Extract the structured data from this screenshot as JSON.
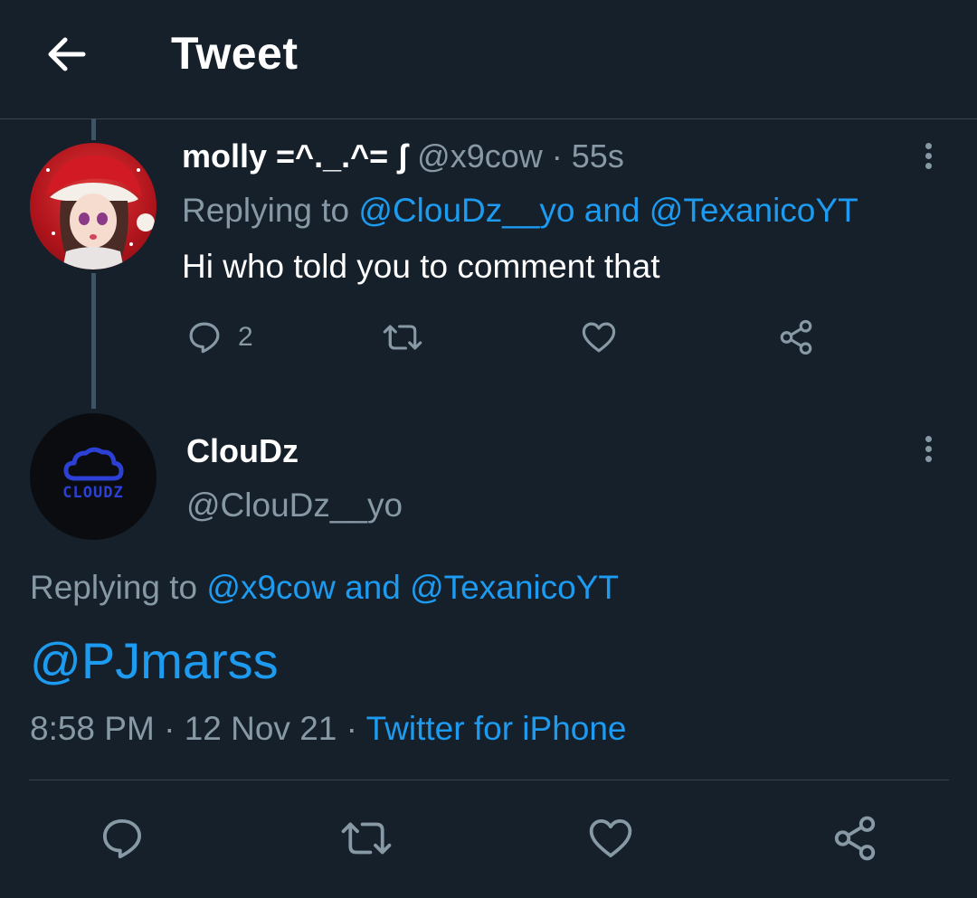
{
  "header": {
    "title": "Tweet",
    "back_icon": "arrow-left-icon"
  },
  "parent_tweet": {
    "display_name": "molly =^._.^= ʃ",
    "handle": "@x9cow",
    "separator": "·",
    "time": "55s",
    "replying_prefix": "Replying to",
    "replying_user1": "@ClouDz__yo",
    "replying_and": "and",
    "replying_user2": "@TexanicoYT",
    "text": "Hi who told you to comment that",
    "reply_count": "2",
    "icons": [
      "reply-icon",
      "retweet-icon",
      "like-icon",
      "share-icon"
    ]
  },
  "main_tweet": {
    "display_name": "ClouDz",
    "handle": "@ClouDz__yo",
    "avatar_text": "CLOUDZ",
    "replying_prefix": "Replying to",
    "replying_user1": "@x9cow",
    "replying_and": "and",
    "replying_user2": "@TexanicoYT",
    "text": "@PJmarss",
    "time": "8:58 PM",
    "dot": "·",
    "date": "12 Nov 21",
    "dot2": "·",
    "source": "Twitter for iPhone",
    "icons": [
      "reply-icon",
      "retweet-icon",
      "like-icon",
      "share-icon"
    ]
  },
  "colors": {
    "background": "#15202b",
    "accent": "#1d9bf0",
    "muted": "#8899a6",
    "divider": "#38444d"
  }
}
